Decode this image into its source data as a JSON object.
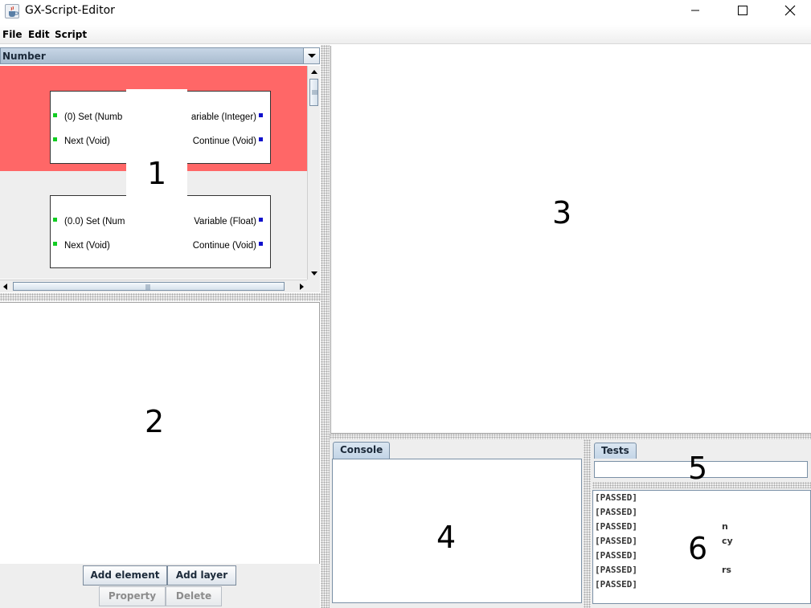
{
  "window": {
    "title": "GX-Script-Editor"
  },
  "menu": [
    "File",
    "Edit",
    "Script"
  ],
  "palette": {
    "category": "Number",
    "nodes": [
      {
        "inputs": [
          "(0) Set (Numb",
          "Next (Void)"
        ],
        "outputs": [
          "ariable (Integer)",
          "Continue (Void)"
        ],
        "selected": true
      },
      {
        "inputs": [
          "(0.0) Set (Num",
          "Next (Void)"
        ],
        "outputs": [
          "Variable (Float)",
          "Continue (Void)"
        ],
        "selected": false
      }
    ]
  },
  "buttons": {
    "add_element": "Add element",
    "add_layer": "Add layer",
    "property": "Property",
    "delete": "Delete"
  },
  "tabs": {
    "console": "Console",
    "tests": "Tests"
  },
  "test_results": [
    {
      "status": "[PASSED]",
      "tail": ""
    },
    {
      "status": "[PASSED]",
      "tail": ""
    },
    {
      "status": "[PASSED]",
      "tail": "n"
    },
    {
      "status": "[PASSED]",
      "tail": "cy"
    },
    {
      "status": "[PASSED]",
      "tail": ""
    },
    {
      "status": "[PASSED]",
      "tail": "rs"
    },
    {
      "status": "[PASSED]",
      "tail": ""
    }
  ],
  "region_markers": [
    "1",
    "2",
    "3",
    "4",
    "5",
    "6"
  ],
  "colors": {
    "selected_node_bg": "#ff6767",
    "input_pin": "#11cc22",
    "output_pin": "#1111cc"
  }
}
